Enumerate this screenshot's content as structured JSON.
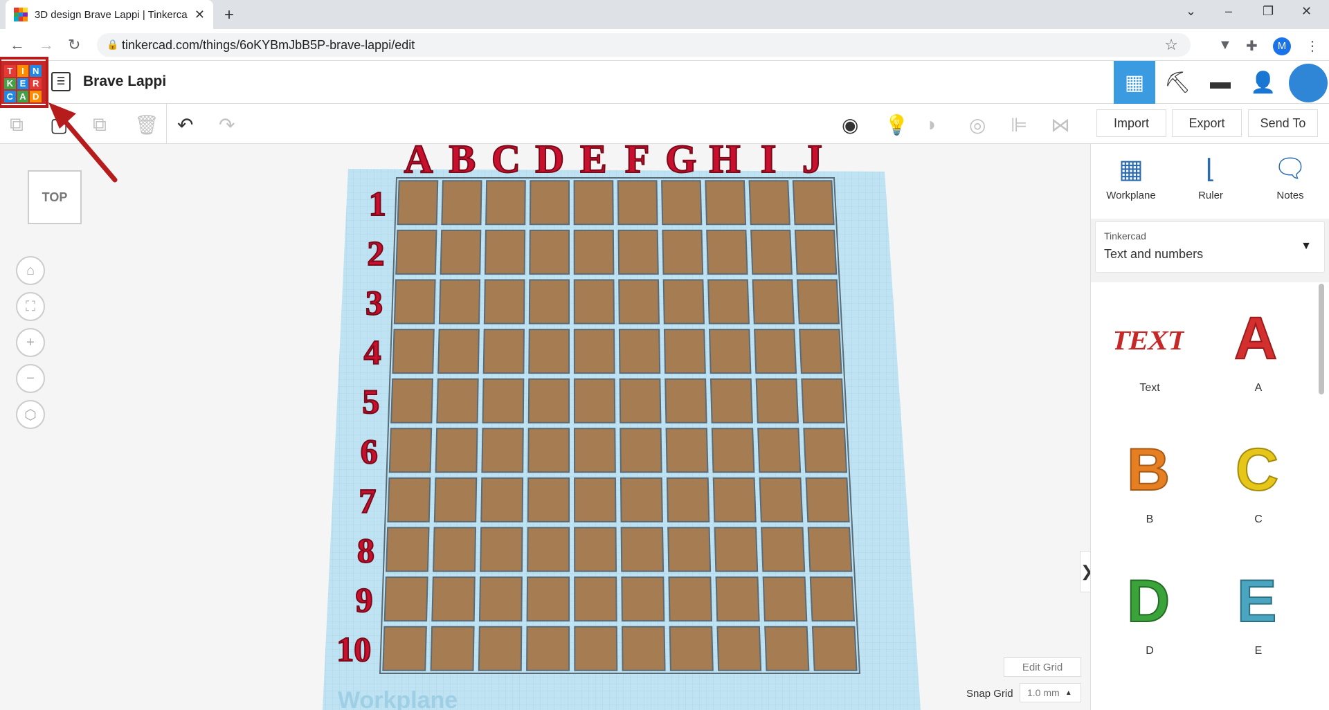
{
  "browser": {
    "tab_title": "3D design Brave Lappi | Tinkercad",
    "tab_close": "✕",
    "new_tab": "+",
    "url": "tinkercad.com/things/6oKYBmJbB5P-brave-lappi/edit",
    "profile_initial": "M",
    "window_minimize": "–",
    "window_restore": "❐",
    "window_close": "✕"
  },
  "app": {
    "logo_letters": [
      "T",
      "I",
      "N",
      "K",
      "E",
      "R",
      "C",
      "A",
      "D"
    ],
    "design_name": "Brave Lappi"
  },
  "toolbar": {
    "import_label": "Import",
    "export_label": "Export",
    "send_to_label": "Send To"
  },
  "workspace": {
    "view_cube_label": "TOP",
    "column_letters": [
      "A",
      "B",
      "C",
      "D",
      "E",
      "F",
      "G",
      "H",
      "I",
      "J"
    ],
    "row_numbers": [
      "1",
      "2",
      "3",
      "4",
      "5",
      "6",
      "7",
      "8",
      "9",
      "10"
    ],
    "workplane_text": "Workplane",
    "edit_grid_label": "Edit Grid",
    "snap_grid_label": "Snap Grid",
    "snap_grid_value": "1.0 mm",
    "collapse_glyph": "❯"
  },
  "panel": {
    "tools": [
      {
        "label": "Workplane",
        "icon": "workplane-icon"
      },
      {
        "label": "Ruler",
        "icon": "ruler-icon"
      },
      {
        "label": "Notes",
        "icon": "notes-icon"
      }
    ],
    "library_source": "Tinkercad",
    "library_category": "Text and numbers",
    "shapes": [
      {
        "label": "Text",
        "color": "#c62828"
      },
      {
        "label": "A",
        "color": "#d32f2f"
      },
      {
        "label": "B",
        "color": "#e67e22"
      },
      {
        "label": "C",
        "color": "#e6c619"
      },
      {
        "label": "D",
        "color": "#3aa33a"
      },
      {
        "label": "E",
        "color": "#4aa6c0"
      }
    ]
  },
  "colors": {
    "accent_blue": "#3a9be0",
    "logo_red": "#c62828",
    "grid_cell": "#a67c52",
    "workplane": "#bfe3f2",
    "letters": "#c8102e"
  }
}
